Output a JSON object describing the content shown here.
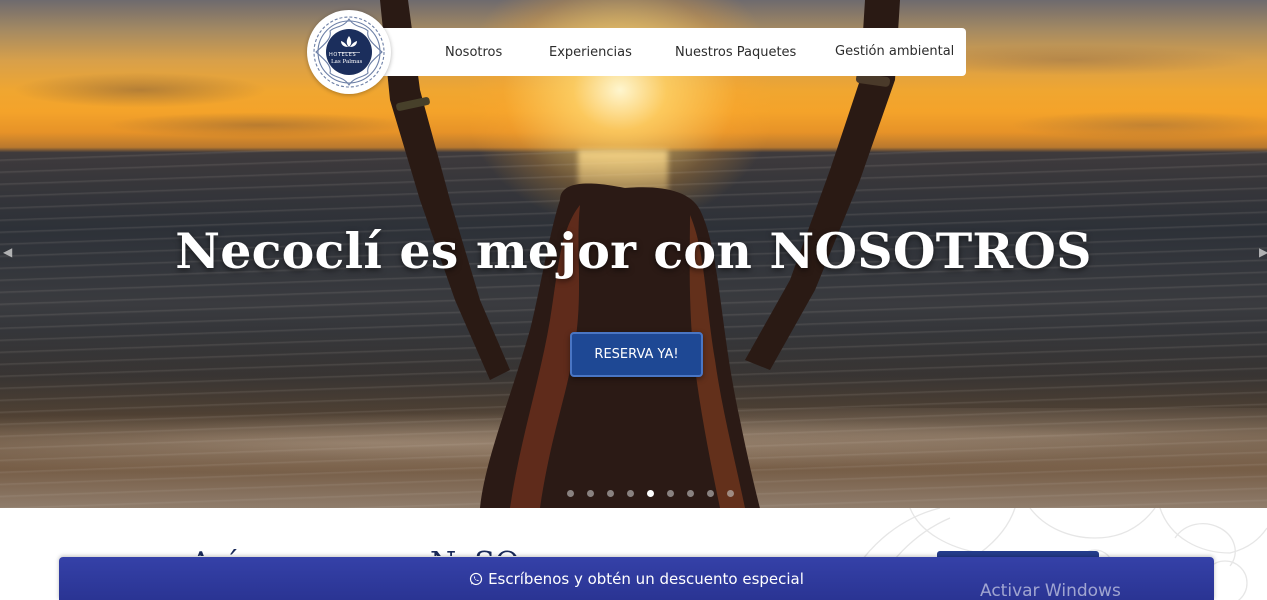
{
  "brand": {
    "logo_line1": "HOTELES",
    "logo_line2": "Las Palmas",
    "navy": "#1b2e5c"
  },
  "nav": {
    "items": [
      {
        "label": "Nosotros"
      },
      {
        "label": "Experiencias"
      },
      {
        "label": "Nuestros Paquetes"
      },
      {
        "label": "Gestión ambiental"
      }
    ]
  },
  "hero": {
    "title": "Necoclí es mejor con NOSOTROS",
    "cta_label": "RESERVA YA!",
    "cta_color": "#1e4894",
    "prev_icon": "chevron-left-icon",
    "next_icon": "chevron-right-icon",
    "slides": {
      "count": 9,
      "active_index": 4
    }
  },
  "section_below": {
    "heading_left_fragment": "Así",
    "heading_mid_fragment": "NoSO"
  },
  "whatsapp_bar": {
    "icon": "whatsapp-icon",
    "label": "Escríbenos y obtén un descuento especial",
    "color": "#2f3a9f"
  },
  "os_overlay": {
    "watermark": "Activar Windows"
  }
}
